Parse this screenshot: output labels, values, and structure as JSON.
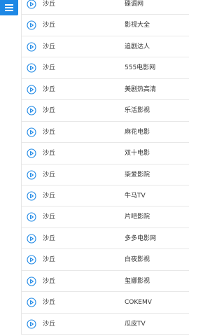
{
  "menu": {
    "icon": "hamburger-menu-icon"
  },
  "list_icon": "play-circle-icon",
  "accent_color": "#1e88e5",
  "rows": [
    {
      "title": "沙丘",
      "source": "碟调网"
    },
    {
      "title": "沙丘",
      "source": "影视大全"
    },
    {
      "title": "沙丘",
      "source": "追剧达人"
    },
    {
      "title": "沙丘",
      "source": "555电影网"
    },
    {
      "title": "沙丘",
      "source": "美剧热高清"
    },
    {
      "title": "沙丘",
      "source": "乐活影视"
    },
    {
      "title": "沙丘",
      "source": "麻花电影"
    },
    {
      "title": "沙丘",
      "source": "双十电影"
    },
    {
      "title": "沙丘",
      "source": "柒爱影院"
    },
    {
      "title": "沙丘",
      "source": "牛马TV"
    },
    {
      "title": "沙丘",
      "source": "片吧影院"
    },
    {
      "title": "沙丘",
      "source": "多多电影网"
    },
    {
      "title": "沙丘",
      "source": "白夜影视"
    },
    {
      "title": "沙丘",
      "source": "玺娜影视"
    },
    {
      "title": "沙丘",
      "source": "COKEMV"
    },
    {
      "title": "沙丘",
      "source": "瓜皮TV"
    }
  ]
}
